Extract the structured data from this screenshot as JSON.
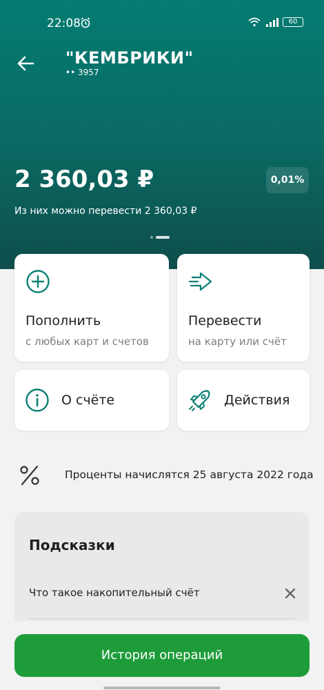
{
  "status_bar": {
    "time": "22:08",
    "battery": "60"
  },
  "header": {
    "title": "\"КЕМБРИКИ\"",
    "account_number": "•• 3957"
  },
  "balance": {
    "amount": "2 360,03 ₽",
    "rate": "0,01%",
    "transfer_note": "Из них можно перевести 2 360,03 ₽"
  },
  "actions": {
    "top_up": {
      "title": "Пополнить",
      "subtitle": "с любых карт и счетов"
    },
    "transfer": {
      "title": "Перевести",
      "subtitle": "на карту или счёт"
    },
    "about": {
      "label": "О счёте"
    },
    "actions": {
      "label": "Действия"
    }
  },
  "interest": {
    "text": "Проценты начислятся 25 августа 2022 года"
  },
  "hints": {
    "title": "Подсказки",
    "items": [
      {
        "label": "Что такое накопительный счёт"
      }
    ]
  },
  "bottom": {
    "history_button": "История операций"
  },
  "colors": {
    "accent": "#0a7f74",
    "button": "#1e9c3a"
  }
}
